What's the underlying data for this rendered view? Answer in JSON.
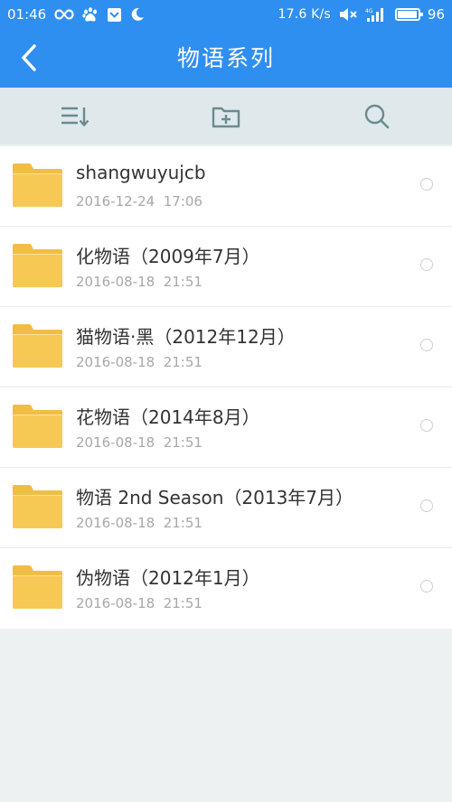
{
  "status_bar": {
    "time": "01:46",
    "net_speed": "17.6 K/s",
    "battery": "96",
    "battery_level_percent": 96,
    "icons": [
      "infinity-icon",
      "baidu-paw-icon",
      "notification-box-icon",
      "moon-icon",
      "mute-icon",
      "4g-signal-icon",
      "battery-icon"
    ]
  },
  "header": {
    "title": "物语系列",
    "back_icon": "chevron-left-icon",
    "background": "#2f8ff0"
  },
  "toolbar": {
    "items": [
      {
        "name": "sort-button",
        "icon": "sort-list-icon"
      },
      {
        "name": "new-folder-button",
        "icon": "folder-add-icon"
      },
      {
        "name": "search-button",
        "icon": "search-icon"
      }
    ]
  },
  "files": [
    {
      "name": "shangwuyujcb",
      "date": "2016-12-24  17:06"
    },
    {
      "name": "化物语（2009年7月）",
      "date": "2016-08-18  21:51"
    },
    {
      "name": "猫物语·黑（2012年12月）",
      "date": "2016-08-18  21:51"
    },
    {
      "name": "花物语（2014年8月）",
      "date": "2016-08-18  21:51"
    },
    {
      "name": "物语 2nd Season（2013年7月）",
      "date": "2016-08-18  21:51"
    },
    {
      "name": "伪物语（2012年1月）",
      "date": "2016-08-18  21:51"
    }
  ],
  "colors": {
    "accent": "#2f8ff0",
    "folder": "#f4c34d",
    "toolbar_bg": "#dfe9ec",
    "page_bg": "#eef1f2"
  }
}
